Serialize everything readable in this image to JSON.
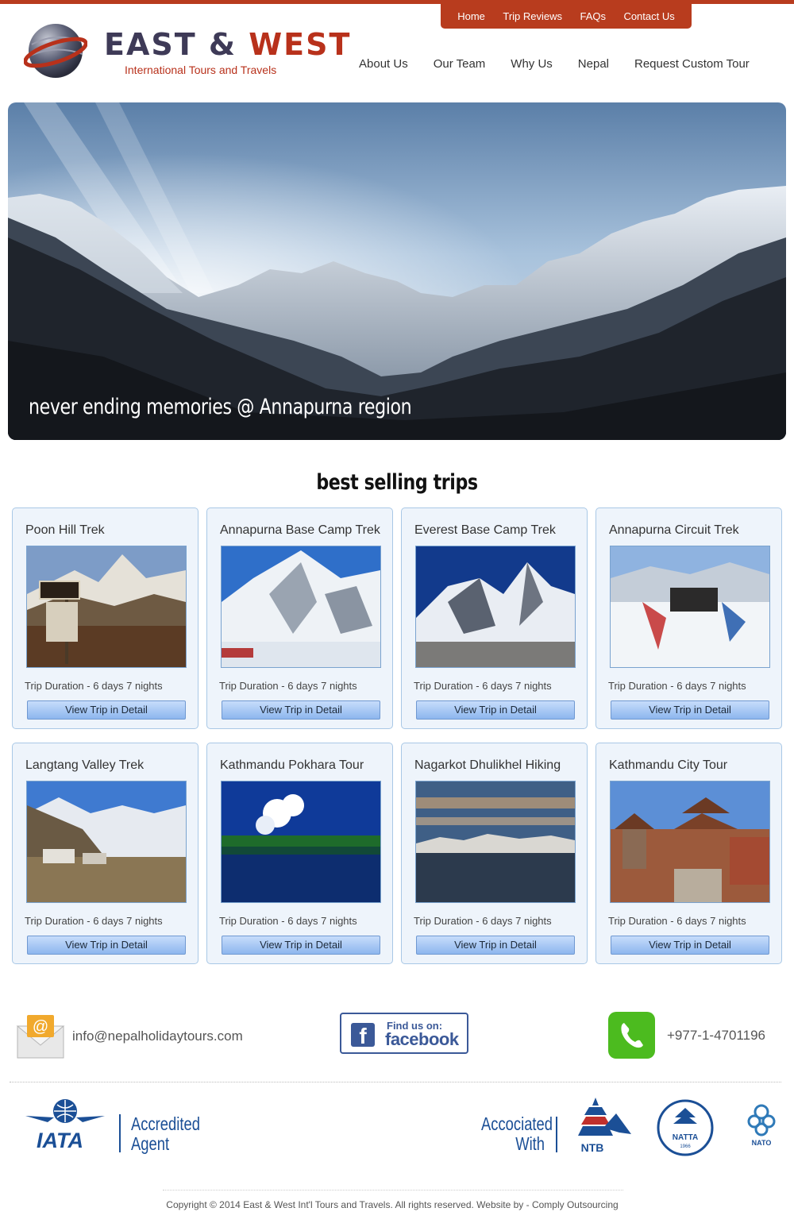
{
  "topnav": [
    "Home",
    "Trip Reviews",
    "FAQs",
    "Contact Us"
  ],
  "logo": {
    "name_part1": "EAST &",
    "name_part2": "WEST",
    "tagline": "International Tours and Travels"
  },
  "mainnav": [
    "About Us",
    "Our Team",
    "Why Us",
    "Nepal",
    "Request Custom Tour"
  ],
  "hero": {
    "caption": "never ending memories @ Annapurna region"
  },
  "trips_title": "best selling trips",
  "trips": [
    {
      "title": "Poon Hill Trek",
      "duration": "Trip Duration - 6 days 7 nights",
      "button": "View Trip in Detail"
    },
    {
      "title": "Annapurna Base Camp Trek",
      "duration": "Trip Duration - 6 days 7 nights",
      "button": "View Trip in Detail"
    },
    {
      "title": "Everest Base Camp Trek",
      "duration": "Trip Duration - 6 days 7 nights",
      "button": "View Trip in Detail"
    },
    {
      "title": "Annapurna Circuit Trek",
      "duration": "Trip Duration - 6 days 7 nights",
      "button": "View Trip in Detail"
    },
    {
      "title": "Langtang Valley Trek",
      "duration": "Trip Duration - 6 days 7 nights",
      "button": "View Trip in Detail"
    },
    {
      "title": "Kathmandu Pokhara Tour",
      "duration": "Trip Duration - 6 days 7 nights",
      "button": "View Trip in Detail"
    },
    {
      "title": "Nagarkot Dhulikhel Hiking",
      "duration": "Trip Duration - 6 days 7 nights",
      "button": "View Trip in Detail"
    },
    {
      "title": "Kathmandu City Tour",
      "duration": "Trip Duration - 6 days 7 nights",
      "button": "View Trip in Detail"
    }
  ],
  "contact": {
    "email": "info@nepalholidaytours.com",
    "facebook_line1": "Find us on:",
    "facebook_line2": "facebook",
    "phone": "+977-1-4701196"
  },
  "accreditation": {
    "iata": "IATA",
    "iata_text_1": "Accredited",
    "iata_text_2": "Agent",
    "assoc_1": "Accociated",
    "assoc_2": "With",
    "ntb": "NTB",
    "natta": "NATTA",
    "natta_year": "1966",
    "nato": "NATO"
  },
  "footer": "Copyright © 2014 East & West Int'l Tours and Travels. All rights reserved. Website by - Comply Outsourcing",
  "colors": {
    "brand_red": "#b83c1e",
    "navy": "#3e3a57",
    "accent_blue": "#1b4f96",
    "facebook": "#3b5998",
    "phone_green": "#4cbb1f"
  }
}
